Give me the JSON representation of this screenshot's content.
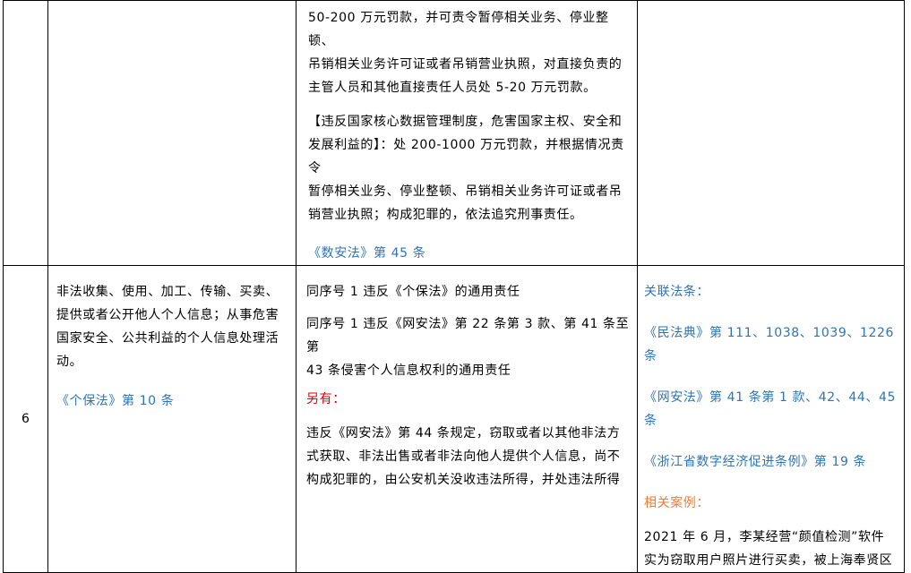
{
  "row_top": {
    "penalty": {
      "lines_a": [
        "50-200 万元罚款，并可责令暂停相关业务、停业整顿、",
        "吊销相关业务许可证或者吊销营业执照，对直接负责的",
        "主管人员和其他直接责任人员处 5-20 万元罚款。"
      ],
      "lines_b": [
        "【违反国家核心数据管理制度，危害国家主权、安全和",
        "发展利益的】：处 200-1000 万元罚款，并根据情况责令",
        "暂停相关业务、停业整顿、吊销相关业务许可证或者吊",
        "销营业执照；构成犯罪的，依法追究刑事责任。"
      ],
      "reference": "《数安法》第 45 条"
    }
  },
  "row_6": {
    "number": "6",
    "behavior": {
      "lines": [
        "非法收集、使用、加工、传输、买卖、",
        "提供或者公开他人个人信息；从事危害",
        "国家安全、公共利益的个人信息处理活",
        "动。"
      ],
      "reference": "《个保法》第 10 条"
    },
    "liability": {
      "line1": "同序号 1 违反《个保法》的通用责任",
      "line2": [
        "同序号 1 违反《网安法》第 22 条第 3 款、第 41 条至第",
        "43 条侵害个人信息权利的通用责任"
      ],
      "also_label": "另有：",
      "line3": [
        "违反《网安法》第 44 条规定，窃取或者以其他非法方",
        "式获取、非法出售或者非法向他人提供个人信息，尚不",
        "构成犯罪的，由公安机关没收违法所得，并处违法所得"
      ]
    },
    "related": {
      "label": "关联法条：",
      "laws": [
        "《民法典》第 111、1038、1039、1226 条",
        "《网安法》第 41 条第 1 款、42、44、45 条",
        "《浙江省数字经济促进条例》第 19 条"
      ],
      "case_label": "相关案例：",
      "case_lines": [
        "2021 年 6 月，李某经营“颜值检测”软件",
        "实为窃取用户照片进行买卖，被上海奉贤区"
      ]
    }
  },
  "colors": {
    "link_blue": "#2e74b5",
    "red": "#e00000",
    "orange": "#ed7d31"
  }
}
